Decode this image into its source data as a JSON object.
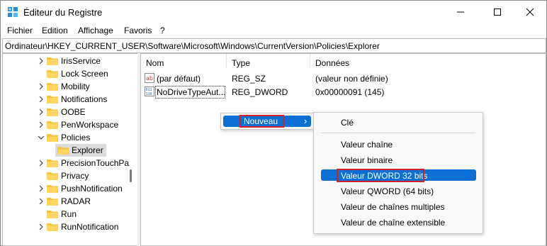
{
  "window": {
    "title": "Éditeur du Registre"
  },
  "menu": [
    "Fichier",
    "Edition",
    "Affichage",
    "Favoris",
    "?"
  ],
  "address": "Ordinateur\\HKEY_CURRENT_USER\\Software\\Microsoft\\Windows\\CurrentVersion\\Policies\\Explorer",
  "tree": [
    {
      "label": "IrisService"
    },
    {
      "label": "Lock Screen"
    },
    {
      "label": "Mobility"
    },
    {
      "label": "Notifications"
    },
    {
      "label": "OOBE"
    },
    {
      "label": "PenWorkspace"
    },
    {
      "label": "Policies"
    },
    {
      "label": "Explorer"
    },
    {
      "label": "PrecisionTouchPa"
    },
    {
      "label": "Privacy"
    },
    {
      "label": "PushNotification"
    },
    {
      "label": "RADAR"
    },
    {
      "label": "Run"
    },
    {
      "label": "RunNotification"
    }
  ],
  "columns": {
    "name": "Nom",
    "type": "Type",
    "data": "Données"
  },
  "values": [
    {
      "name": "(par défaut)",
      "type": "REG_SZ",
      "data": "(valeur non définie)",
      "icon": "string-value-icon"
    },
    {
      "name": "NoDriveTypeAut...",
      "type": "REG_DWORD",
      "data": "0x00000091 (145)",
      "icon": "binary-value-icon"
    }
  ],
  "context_menu": {
    "label": "Nouveau",
    "arrow": "›"
  },
  "submenu": [
    "Clé",
    "Valeur chaîne",
    "Valeur binaire",
    "Valeur DWORD 32 bits",
    "Valeur QWORD (64 bits)",
    "Valeur de chaînes multiples",
    "Valeur de chaîne extensible"
  ],
  "colors": {
    "highlight": "#0b6fd3",
    "annotation": "#d0202a",
    "folder": "#f4c542"
  }
}
